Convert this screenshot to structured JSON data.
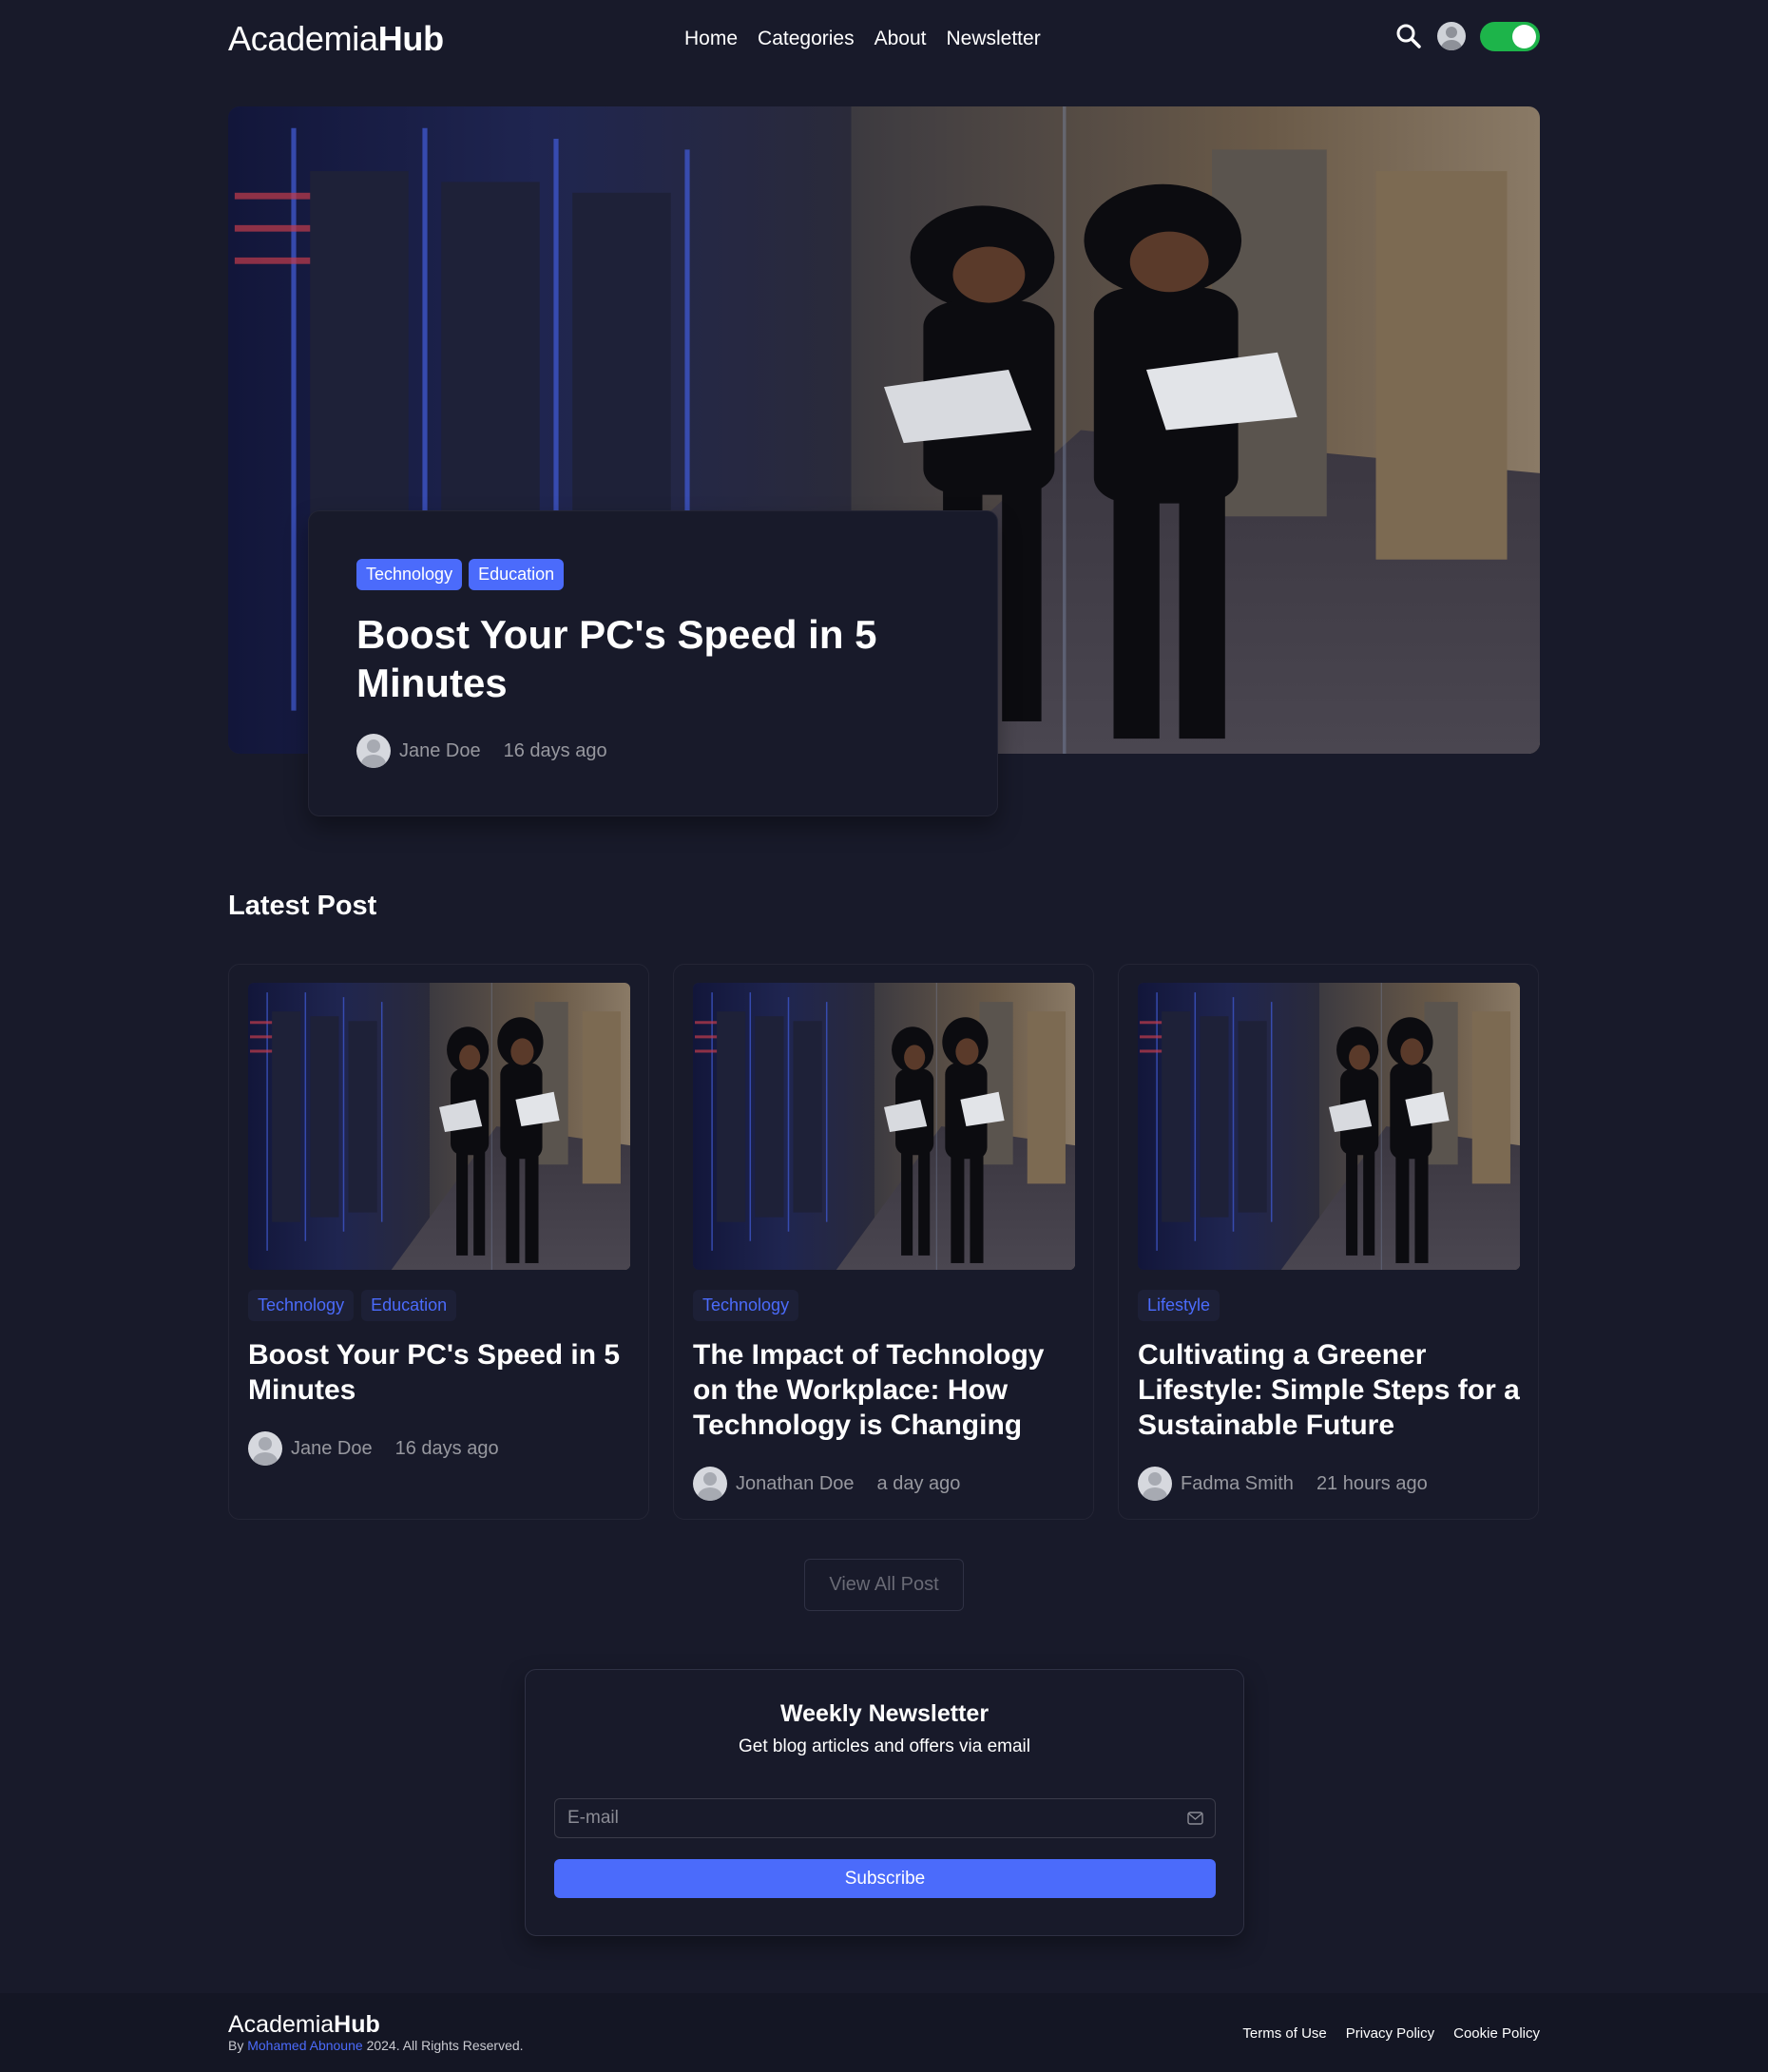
{
  "header": {
    "logo_light": "Academia",
    "logo_bold": "Hub",
    "nav": [
      "Home",
      "Categories",
      "About",
      "Newsletter"
    ],
    "toggle_on": true
  },
  "hero": {
    "tags": [
      "Technology",
      "Education"
    ],
    "title": "Boost Your PC's Speed in 5 Minutes",
    "author": "Jane Doe",
    "date": "16 days ago"
  },
  "latest": {
    "heading": "Latest Post",
    "posts": [
      {
        "tags": [
          "Technology",
          "Education"
        ],
        "title": "Boost Your PC's Speed in 5 Minutes",
        "author": "Jane Doe",
        "date": "16 days ago"
      },
      {
        "tags": [
          "Technology"
        ],
        "title": "The Impact of Technology on the Workplace: How Technology is Changing",
        "author": "Jonathan Doe",
        "date": "a day ago"
      },
      {
        "tags": [
          "Lifestyle"
        ],
        "title": "Cultivating a Greener Lifestyle: Simple Steps for a Sustainable Future",
        "author": "Fadma Smith",
        "date": "21 hours ago"
      }
    ],
    "view_all": "View All Post"
  },
  "newsletter": {
    "title": "Weekly Newsletter",
    "subtitle": "Get blog articles and offers via email",
    "placeholder": "E-mail",
    "button": "Subscribe"
  },
  "footer": {
    "logo_light": "Academia",
    "logo_bold": "Hub",
    "copy_prefix": "By",
    "author_link": "Mohamed Abnoune",
    "copy_suffix": "2024. All Rights Reserved.",
    "links": [
      "Terms of Use",
      "Privacy Policy",
      "Cookie Policy"
    ]
  },
  "colors": {
    "background": "#181a2a",
    "accent": "#4b6bfb",
    "toggle": "#1db44a",
    "muted_text": "#97989f"
  },
  "icons": [
    "search-icon",
    "user-avatar-icon",
    "theme-toggle",
    "mail-icon"
  ]
}
